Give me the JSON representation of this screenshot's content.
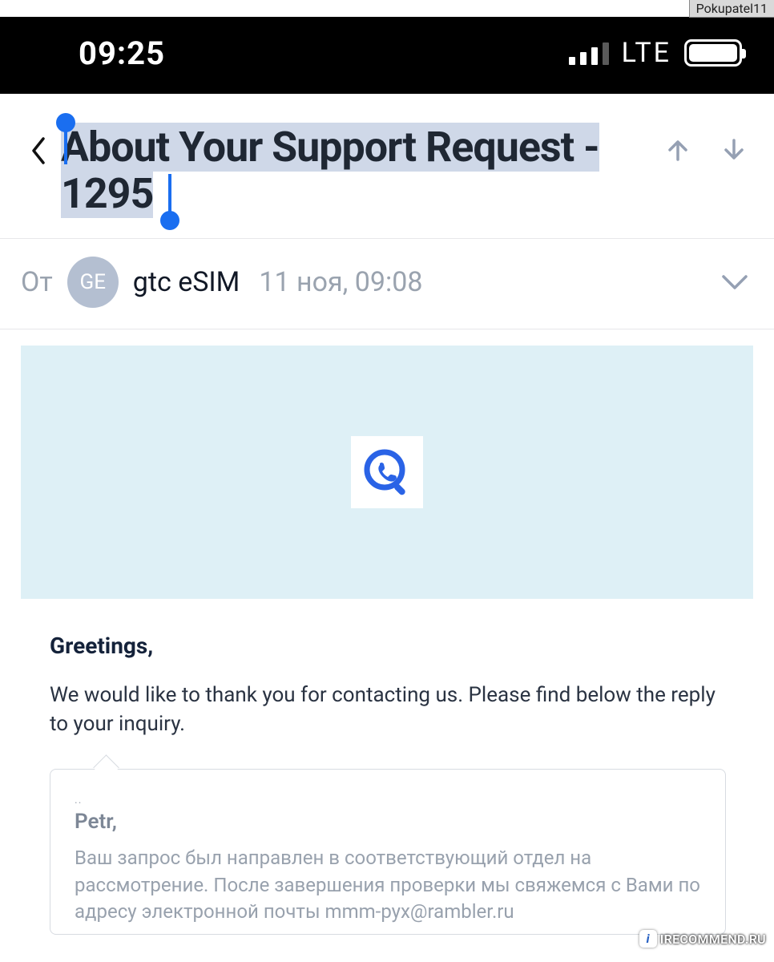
{
  "watermark": {
    "top_right": "Pokupatel11",
    "bottom_right": "IRECOMMEND.RU",
    "bottom_right_badge": "i"
  },
  "status": {
    "time": "09:25",
    "network_label": "LTE"
  },
  "email": {
    "subject": "About Your Support Request - 1295",
    "from_label": "От",
    "avatar_initials": "GE",
    "sender_name": "gtc eSIM",
    "sent_date": "11 ноя, 09:08",
    "greeting": "Greetings,",
    "intro": "We would like to thank you for contacting us. Please find below the reply to your inquiry.",
    "quote": {
      "addressee": "Petr,",
      "body": "Ваш запрос был направлен в соответствующий отдел на рассмотрение. После завершения проверки мы свяжемся с Вами по адресу электронной почты mmm-pyx@rambler.ru"
    }
  }
}
